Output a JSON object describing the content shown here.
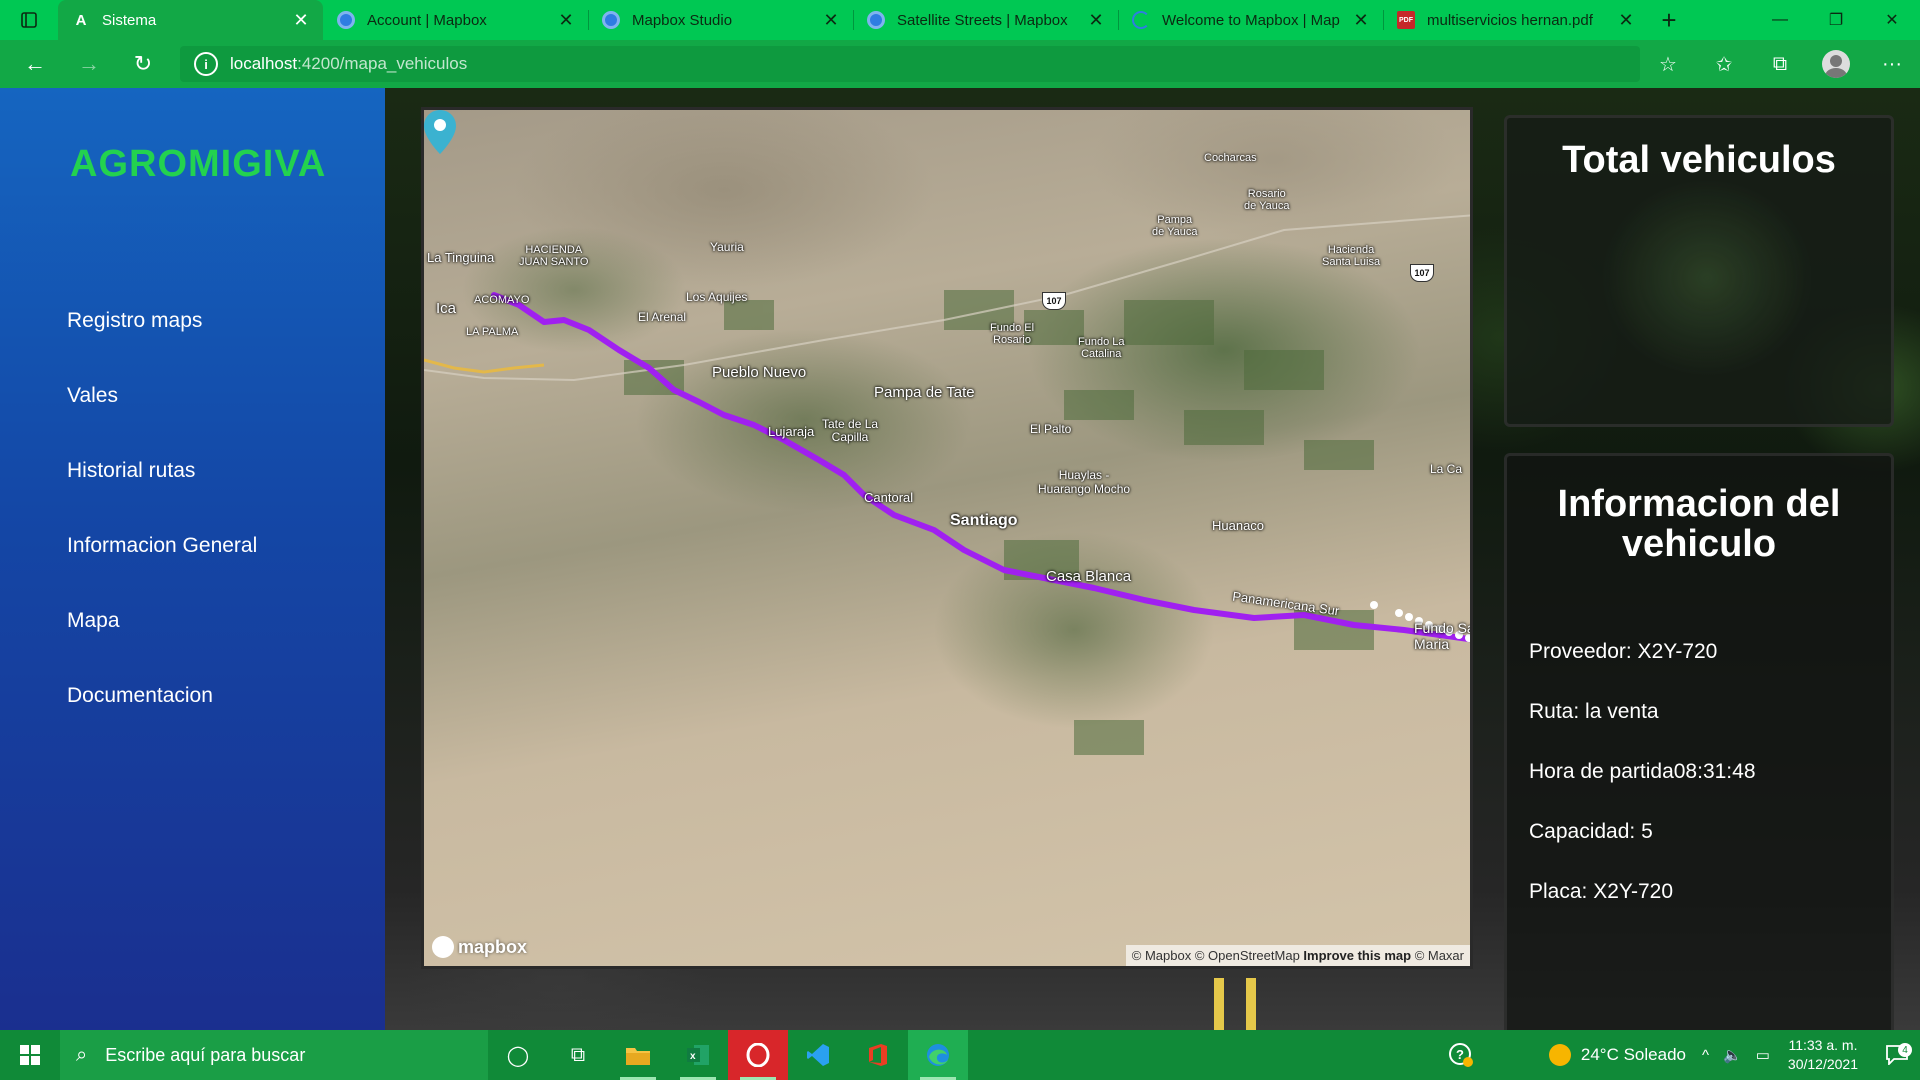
{
  "browser": {
    "tabs": [
      {
        "title": "Sistema",
        "icon": "angular-icon",
        "active": true
      },
      {
        "title": "Account | Mapbox",
        "icon": "mapbox-icon"
      },
      {
        "title": "Mapbox Studio",
        "icon": "mapbox-icon"
      },
      {
        "title": "Satellite Streets | Mapbox",
        "icon": "mapbox-icon"
      },
      {
        "title": "Welcome to Mapbox | Map",
        "icon": "loading-icon"
      },
      {
        "title": "multiservicios hernan.pdf",
        "icon": "pdf-icon"
      }
    ],
    "url_host": "localhost",
    "url_path": ":4200/mapa_vehiculos",
    "chrome_color": "#00c853"
  },
  "sidebar": {
    "brand": "AGROMIGIVA",
    "items": [
      {
        "label": "Registro maps"
      },
      {
        "label": "Vales"
      },
      {
        "label": "Historial rutas"
      },
      {
        "label": "Informacion General"
      },
      {
        "label": "Mapa"
      },
      {
        "label": "Documentacion"
      }
    ]
  },
  "map": {
    "places": {
      "la_tinguina": "La Tinguina",
      "hacienda_juan_santo": "HACIENDA\nJUAN SANTO",
      "yauria": "Yauria",
      "cocharcas": "Cocharcas",
      "rosario_de_yauca": "Rosario\nde Yauca",
      "pampa_de_yauca": "Pampa\nde Yauca",
      "hacienda_santa_luisa": "Hacienda\nSanta Luisa",
      "ica": "Ica",
      "acomayo": "ACOMAYO",
      "la_palma": "LA PALMA",
      "los_aquijes": "Los Aquijes",
      "el_arenal": "El Arenal",
      "fundo_el_rosario": "Fundo El\nRosario",
      "fundo_la_catalina": "Fundo La\nCatalina",
      "pueblo_nuevo": "Pueblo Nuevo",
      "pampa_de_tate": "Pampa de Tate",
      "lujaraja": "Lujaraja",
      "tate_de_la_capilla": "Tate de La\nCapilla",
      "el_palto": "El Palto",
      "huaylas": "Huaylas -\nHuarango Mocho",
      "la_ca": "La Ca",
      "cantoral": "Cantoral",
      "santiago": "Santiago",
      "huanaco": "Huanaco",
      "casa_blanca": "Casa Blanca",
      "panamericana_sur": "Panamericana Sur",
      "fundo_sa_maria": "Fundo Sa\nMaria"
    },
    "route_shields": [
      "107",
      "107"
    ],
    "logo_text": "mapbox",
    "attribution": {
      "mapbox": "© Mapbox",
      "osm": "© OpenStreetMap",
      "improve": "Improve this map",
      "maxar": "© Maxar"
    },
    "route_color": "#a020f0",
    "marker_color": "#3bb2d0"
  },
  "cards": {
    "total_title": "Total vehiculos",
    "info_title": "Informacion del vehiculo",
    "info_lines": [
      "Proveedor: X2Y-720",
      "Ruta: la venta",
      "Hora de partida08:31:48",
      "Capacidad: 5",
      "Placa: X2Y-720"
    ]
  },
  "taskbar": {
    "search_placeholder": "Escribe aquí para buscar",
    "weather": "24°C  Soleado",
    "time": "11:33 a. m.",
    "date": "30/12/2021",
    "notifications": "4",
    "apps": [
      "cortana-icon",
      "task-view-icon",
      "file-explorer-icon",
      "excel-icon",
      "opera-icon",
      "vscode-icon",
      "office-icon",
      "edge-icon"
    ]
  }
}
